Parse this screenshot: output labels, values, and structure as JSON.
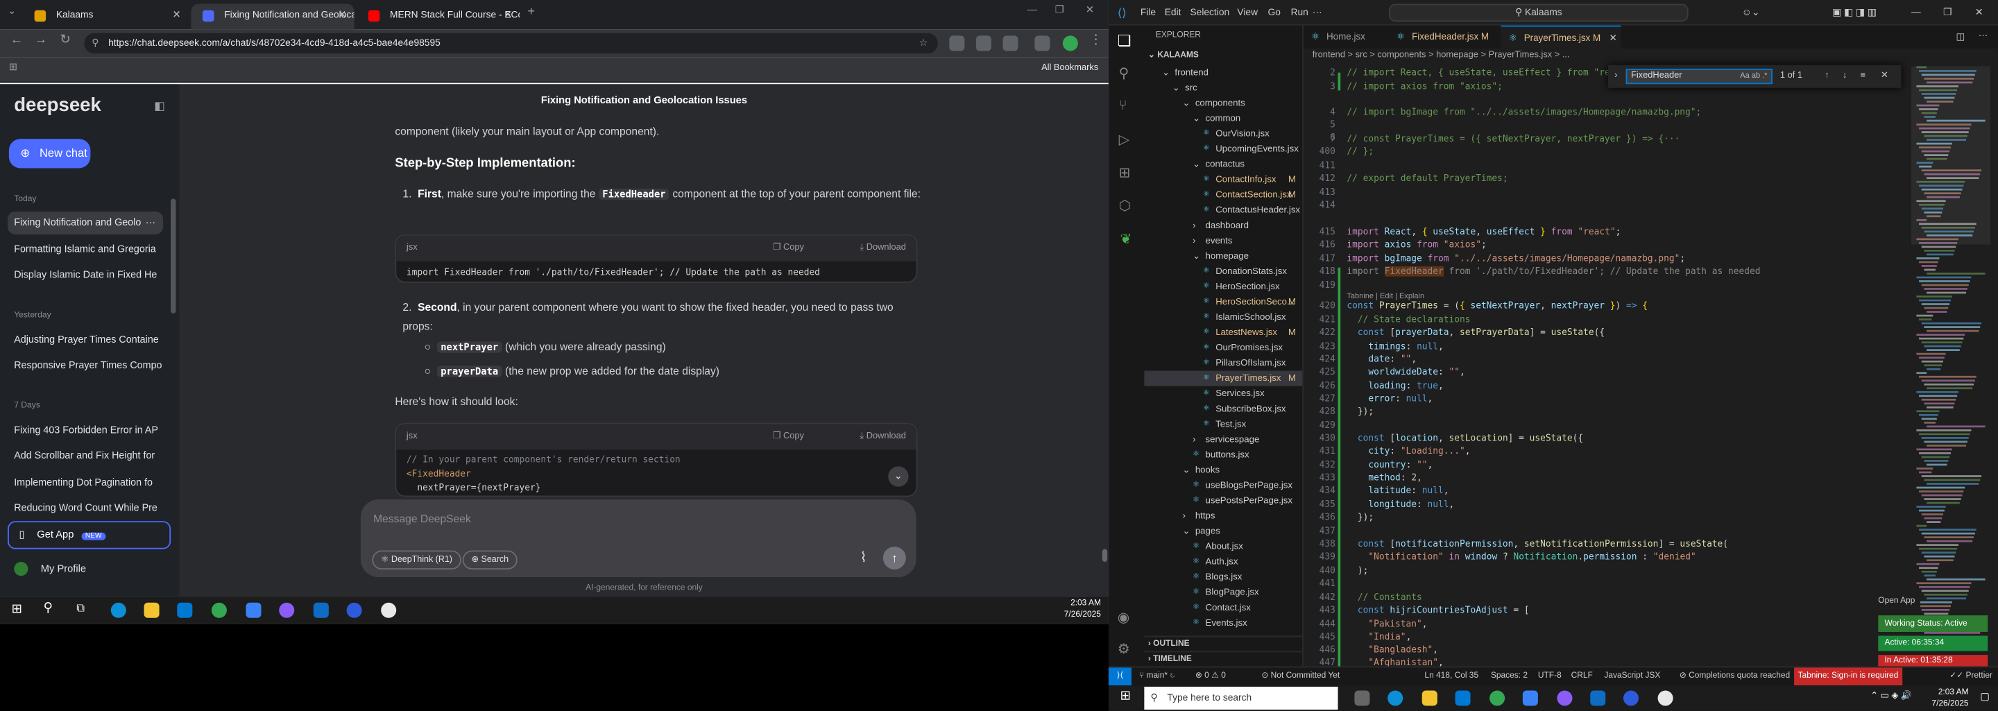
{
  "tabs": [
    {
      "label": "Kalaams",
      "active": false
    },
    {
      "label": "Fixing Notification and Geoloca",
      "active": true
    },
    {
      "label": "MERN Stack Full Course - ECom",
      "active": false
    }
  ],
  "url": "https://chat.deepseek.com/a/chat/s/48702e34-4cd9-418d-a4c5-bae4e4e98595",
  "bookmarks_label": "All Bookmarks",
  "deepseek": {
    "logo": "deepseek",
    "new_chat": "New chat",
    "sections": [
      {
        "label": "Today",
        "items": [
          "Fixing Notification and Geolo",
          "Formatting Islamic and Gregoria",
          "Display Islamic Date in Fixed He"
        ]
      },
      {
        "label": "Yesterday",
        "items": [
          "Adjusting Prayer Times Containe",
          "Responsive Prayer Times Compo"
        ]
      },
      {
        "label": "7 Days",
        "items": [
          "Fixing 403 Forbidden Error in AP",
          "Add Scrollbar and Fix Height for",
          "Implementing Dot Pagination fo",
          "Reducing Word Count While Pre"
        ]
      }
    ],
    "get_app": "Get App",
    "new_badge": "NEW",
    "profile": "My Profile"
  },
  "chat": {
    "title": "Fixing Notification and Geolocation Issues",
    "intro": "component (likely your main layout or App component).",
    "heading": "Step-by-Step Implementation:",
    "step1_pre": "First",
    "step1_mid": ", make sure you're importing the ",
    "step1_chip": "FixedHeader",
    "step1_post": " component at the top of your parent component file:",
    "code1_lang": "jsx",
    "copy": "Copy",
    "download": "Download",
    "code1": "import FixedHeader from './path/to/FixedHeader'; // Update the path as needed",
    "step2_pre": "Second",
    "step2_post": ", in your parent component where you want to show the fixed header, you need to pass two props:",
    "bullet1_chip": "nextPrayer",
    "bullet1_text": " (which you were already passing)",
    "bullet2_chip": "prayerData",
    "bullet2_text": " (the new prop we added for the date display)",
    "here": "Here's how it should look:",
    "code2_lang": "jsx",
    "code2_l1": "// In your parent component's render/return section",
    "code2_l2": "<FixedHeader",
    "code2_l3": "  nextPrayer={nextPrayer}",
    "placeholder": "Message DeepSeek",
    "deepthink": "DeepThink (R1)",
    "search": "Search",
    "footer": "AI-generated, for reference only"
  },
  "taskbar_left": {
    "time": "2:03 AM",
    "date": "7/26/2025"
  },
  "vscode": {
    "menu": [
      "File",
      "Edit",
      "Selection",
      "View",
      "Go",
      "Run"
    ],
    "search": "Kalaams",
    "explorer_title": "EXPLORER",
    "root": "KALAAMS",
    "tree": [
      {
        "d": 1,
        "name": "frontend",
        "folder": true
      },
      {
        "d": 2,
        "name": "src",
        "folder": true
      },
      {
        "d": 3,
        "name": "components",
        "folder": true
      },
      {
        "d": 4,
        "name": "common",
        "folder": true
      },
      {
        "d": 5,
        "name": "OurVision.jsx"
      },
      {
        "d": 5,
        "name": "UpcomingEvents.jsx"
      },
      {
        "d": 4,
        "name": "contactus",
        "folder": true
      },
      {
        "d": 5,
        "name": "ContactInfo.jsx",
        "mod": "M"
      },
      {
        "d": 5,
        "name": "ContactSection.jsx",
        "mod": "M"
      },
      {
        "d": 5,
        "name": "ContactusHeader.jsx"
      },
      {
        "d": 4,
        "name": "dashboard",
        "folder": true,
        "closed": true
      },
      {
        "d": 4,
        "name": "events",
        "folder": true,
        "closed": true
      },
      {
        "d": 4,
        "name": "homepage",
        "folder": true
      },
      {
        "d": 5,
        "name": "DonationStats.jsx"
      },
      {
        "d": 5,
        "name": "HeroSection.jsx"
      },
      {
        "d": 5,
        "name": "HeroSectionSeco...",
        "mod": "M"
      },
      {
        "d": 5,
        "name": "IslamicSchool.jsx"
      },
      {
        "d": 5,
        "name": "LatestNews.jsx",
        "mod": "M"
      },
      {
        "d": 5,
        "name": "OurPromises.jsx"
      },
      {
        "d": 5,
        "name": "PillarsOfIslam.jsx"
      },
      {
        "d": 5,
        "name": "PrayerTimes.jsx",
        "mod": "M",
        "sel": true
      },
      {
        "d": 5,
        "name": "Services.jsx"
      },
      {
        "d": 5,
        "name": "SubscribeBox.jsx"
      },
      {
        "d": 5,
        "name": "Test.jsx"
      },
      {
        "d": 4,
        "name": "servicespage",
        "folder": true,
        "closed": true
      },
      {
        "d": 4,
        "name": "buttons.jsx"
      },
      {
        "d": 3,
        "name": "hooks",
        "folder": true
      },
      {
        "d": 4,
        "name": "useBlogsPerPage.jsx"
      },
      {
        "d": 4,
        "name": "usePostsPerPage.jsx"
      },
      {
        "d": 3,
        "name": "https",
        "folder": true,
        "closed": true
      },
      {
        "d": 3,
        "name": "pages",
        "folder": true
      },
      {
        "d": 4,
        "name": "About.jsx"
      },
      {
        "d": 4,
        "name": "Auth.jsx"
      },
      {
        "d": 4,
        "name": "Blogs.jsx"
      },
      {
        "d": 4,
        "name": "BlogPage.jsx"
      },
      {
        "d": 4,
        "name": "Contact.jsx"
      },
      {
        "d": 4,
        "name": "Events.jsx"
      }
    ],
    "outline": "OUTLINE",
    "timeline": "TIMELINE",
    "editor_tabs": [
      "Home.jsx",
      "FixedHeader.jsx M",
      "PrayerTimes.jsx M"
    ],
    "breadcrumb": "frontend > src > components > homepage > PrayerTimes.jsx > ...",
    "find_query": "FixedHeader",
    "find_count": "1 of 1",
    "status": {
      "branch": "main*",
      "errors": "0",
      "warnings": "0",
      "commit": "Not Committed Yet",
      "pos": "Ln 418, Col 35",
      "spaces": "Spaces: 2",
      "enc": "UTF-8",
      "eol": "CRLF",
      "lang": "JavaScript JSX",
      "quota": "Completions quota reached",
      "tabnine": "Tabnine: Sign-in is required",
      "prettier": "Prettier"
    },
    "codelens": "Tabnine | Edit | Explain",
    "open_app": "Open App",
    "wstatus": "Working Status: Active",
    "active": "Active: 06:35:34",
    "inactive": "In Active: 01:35:28"
  },
  "taskbar_right": {
    "search": "Type here to search",
    "time": "2:03 AM",
    "date": "7/26/2025"
  }
}
